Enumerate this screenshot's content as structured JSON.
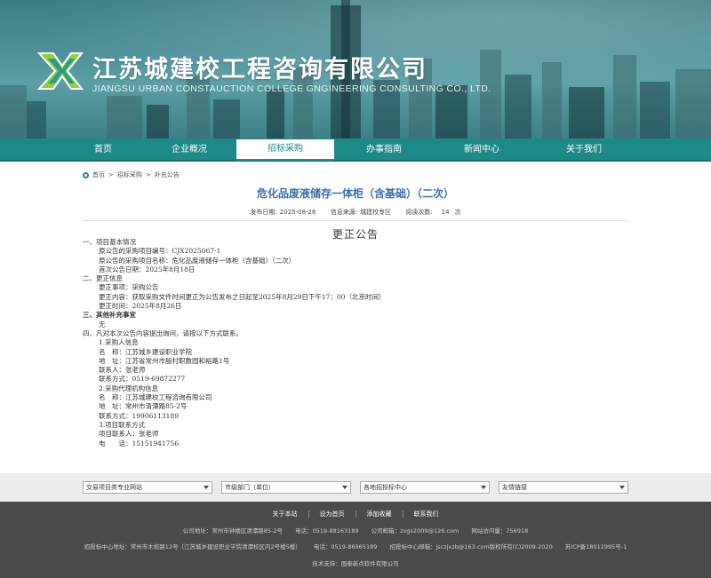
{
  "header": {
    "company_cn": "江苏城建校工程咨询有限公司",
    "company_en": "JIANGSU URBAN CONSTAUCTION COLLEGE GNGINEERING CONSULTING CO., LTD.",
    "logo_icon": "company-logo-icon"
  },
  "nav": {
    "items": [
      "首页",
      "企业概况",
      "招标采购",
      "办事指南",
      "新闻中心",
      "关于我们"
    ],
    "active": "招标采购",
    "bg_color": "#1e8a88"
  },
  "breadcrumb": {
    "home": "首页",
    "sep1": ">",
    "level1": "招标采购",
    "sep2": ">",
    "level2": "补充公告"
  },
  "article": {
    "title": "危化品废液储存一体柜（含基础）（二次）",
    "title_color": "#3a6fb0",
    "publish_label": "发布日期:",
    "publish_date": "2025-08-26",
    "source_label": "信息来源:",
    "source": "城建校专区",
    "views_label": "阅读次数:",
    "views": "14",
    "views_unit": "次",
    "doc_heading": "更正公告",
    "lines": [
      "一、项目基本情况",
      "原公告的采购项目编号：CJX2025067-1",
      "原公告的采购项目名称：危化品废液储存一体柜（含基础）（二次）",
      "首次公告日期：2025年8月18日",
      "二、更正信息",
      "更正事项：采购公告",
      "更正内容：获取采购文件时间更正为公告发布之日起至2025年8月29日下午17：00（北京时间）",
      "更正时间：2025年8月26日",
      "三、其他补充事宜",
      "无",
      "四、凡对本次公告内容提出询问，请按以下方式联系。",
      "1.采购人信息",
      "名　称：江苏城乡建设职业学院",
      "地　址：江苏省常州市殷村职教园和裕路1号",
      "联系人：张老师",
      "联系方式：0519-69872277",
      "2.采购代理机构信息",
      "名　称：江苏城建校工程咨询有限公司",
      "地　址：常州市清潭路85-2号",
      "联系方式：19906113189",
      "3.项目联系方式",
      "项目联系人：张老师",
      "电　　话：15151941756"
    ]
  },
  "links_bar": {
    "selects": [
      "交易项目类专业网站",
      "市级部门（单位）",
      "各地招投标中心",
      "友情链接"
    ]
  },
  "footer": {
    "links": [
      "关于本站",
      "设为首页",
      "添加收藏",
      "联系我们"
    ],
    "line1": [
      "公司地址：常州市钟楼区清潭路85-2号",
      "电话：0519-88163189",
      "公司邮箱：zxgs2009@126.com",
      "网站访问量：756918"
    ],
    "line2": [
      "招投标中心地址：常州市木梳路12号（江苏城乡建设职业学院清潭校区内2号楼5楼）",
      "电话：0519-86965189",
      "招投标中心邮箱：jsczjxzb@163.com版权所有(C)2009-2020",
      "苏ICP备18011995号-1"
    ],
    "tech": "技术支持：国泰新点软件有限公司"
  }
}
